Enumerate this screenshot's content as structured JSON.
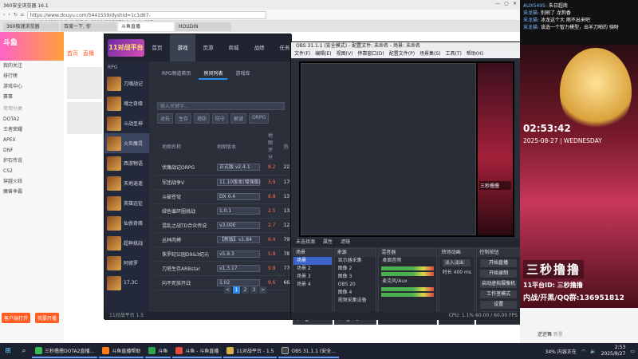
{
  "browser": {
    "title": "360安全浏览器 16.1",
    "url": "https://www.douyu.com/5441559/dyshid=1c1d67-c4a4b1233b0db4bf8fb9e6200d3170ff&dyshci=217",
    "tabs": [
      "360极速浏览器",
      "百度一下, 你",
      "斗鱼直播",
      "HOUDIN"
    ],
    "douyu": {
      "logo": "斗鱼",
      "nav": [
        "首页",
        "直播"
      ],
      "left_items": [
        "我的关注",
        "排行榜",
        "游戏中心",
        "赛事",
        "常用分类"
      ],
      "categories": [
        "DOTA2",
        "王者荣耀",
        "APEX",
        "DNF",
        "炉石传说",
        "CS2",
        "穿越火线",
        "魔兽争霸"
      ],
      "buttons": [
        "客户端打开",
        "我要开播"
      ]
    }
  },
  "gameplatform": {
    "logo": "11对战平台",
    "menu": [
      "首页",
      "游戏",
      "页游",
      "商城",
      "战绩",
      "任务"
    ],
    "side_category": "RPG",
    "games": [
      "刀魂战记",
      "魂之奇缘",
      "斗战圣神",
      "火炎魔灵",
      "西游物语",
      "天地逍遥",
      "英雄远征",
      "仙侠奇缘",
      "超神挑战",
      "阿修罗",
      "17.3C"
    ],
    "subtabs": [
      "RPG频道首页",
      "房间列表",
      "游戏库"
    ],
    "search_placeholder": "输入关键字...",
    "filters": [
      "对抗",
      "生存",
      "塔防",
      "防守",
      "解谜",
      "ORPG"
    ],
    "columns": [
      "地图名称",
      "地图版本",
      "地图评分",
      "热"
    ],
    "rows": [
      {
        "name": "伏魔战记ORPG",
        "version": "正式版 v2.4.1",
        "score": "8.2",
        "heat": "2230"
      },
      {
        "name": "军团战争Ⅴ",
        "version": "11.10版本(增强版)",
        "score": "3.9",
        "heat": "1791"
      },
      {
        "name": "斗破苍穹",
        "version": "DX 0.4",
        "score": "8.8",
        "heat": "1370"
      },
      {
        "name": "绿色循环圈挑战",
        "version": "1.0.1",
        "score": "2.5",
        "heat": "1320"
      },
      {
        "name": "混乱之战TD合众传说",
        "version": "v3.00E",
        "score": "2.7",
        "heat": "1224"
      },
      {
        "name": "丛林肉搏",
        "version": "【新版】v1.84",
        "score": "6.4",
        "heat": "7951"
      },
      {
        "name": "侏罗纪公园D9&3纪元",
        "version": "v5.9.3",
        "score": "5.8",
        "heat": "7871"
      },
      {
        "name": "刀塔生存ARBstar",
        "version": "v1.3.17",
        "score": "9.8",
        "heat": "7760"
      },
      {
        "name": "向不死族开战",
        "version": "1.02",
        "score": "9.6",
        "heat": "6638"
      }
    ],
    "pages": [
      "<",
      "1",
      "2",
      "3",
      ">"
    ],
    "status": "11对战平台 1.5"
  },
  "obs": {
    "title": "OBS 31.1.1 (安全模式) - 配置文件: 未命名 - 场景: 未命名",
    "menu": [
      "文件(F)",
      "编辑(E)",
      "视图(V)",
      "停靠窗口(D)",
      "配置文件(P)",
      "场景集(S)",
      "工具(T)",
      "帮助(H)"
    ],
    "info_bar": [
      "未选择源",
      "属性",
      "滤镜"
    ],
    "docks": {
      "scenes_title": "场景",
      "scenes": [
        "场景",
        "场景 2",
        "场景 3",
        "场景 4"
      ],
      "sources_title": "来源",
      "sources": [
        "显示器采集",
        "图像 2",
        "图像 3",
        "OBS 20",
        "图像 4",
        "视频采集设备"
      ],
      "mixer_title": "混音器",
      "mixer": [
        "桌面音频",
        "麦克风/Aux"
      ],
      "transitions_title": "转场动画",
      "transition": "淡入淡出",
      "duration_label": "时长",
      "duration": "400 ms",
      "controls_title": "控制按钮",
      "controls": [
        "开始直播",
        "开始录制",
        "启动虚拟摄像机",
        "工作室模式",
        "设置",
        "退出"
      ]
    },
    "status": "CPU: 1.1%  60.00 / 60.00 FPS"
  },
  "stream": {
    "chat": [
      {
        "user": "AUX5495:",
        "text": "朱日超南"
      },
      {
        "user": "采龙猫:",
        "text": "别刷了 龙狗香"
      },
      {
        "user": "采龙猫:",
        "text": "冰龙这个大 雨不出来吧"
      },
      {
        "user": "采龙猫:",
        "text": "该选一个智力模型，出羊刀啪的 骑呀"
      }
    ],
    "clock": "02:53:42",
    "date": "2025-08-27",
    "weekday": "WEDNESDAY",
    "streamer_name": "三秒撸撸",
    "platform_id": "11平台ID: 三秒撸撸",
    "qq": "内战/开黑/QQ群:136951812",
    "host_name": "逆逆舞",
    "level": "新星"
  },
  "taskbar": {
    "items": [
      "三秒撸撸DOTA2直播...",
      "斗鱼直播帮助",
      "斗鱼",
      "斗鱼 - 斗鱼直播",
      "11对战平台 - 1.5",
      "OBS 31.1.1 (安全..."
    ],
    "tray_battery": "34%",
    "tray_status": "内容正在",
    "time": "2:53",
    "date": "2025/8/27"
  }
}
